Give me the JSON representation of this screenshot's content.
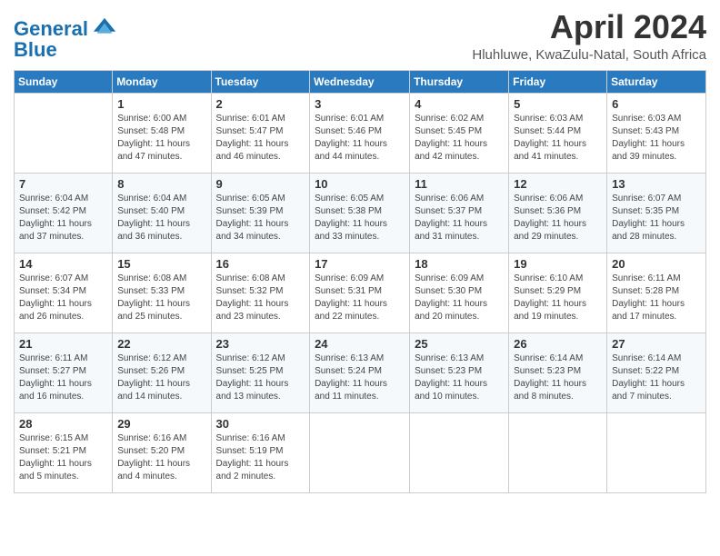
{
  "app": {
    "logo_line1": "General",
    "logo_line2": "Blue"
  },
  "header": {
    "month_year": "April 2024",
    "location": "Hluhluwe, KwaZulu-Natal, South Africa"
  },
  "calendar": {
    "days_of_week": [
      "Sunday",
      "Monday",
      "Tuesday",
      "Wednesday",
      "Thursday",
      "Friday",
      "Saturday"
    ],
    "weeks": [
      [
        {
          "day": "",
          "info": ""
        },
        {
          "day": "1",
          "info": "Sunrise: 6:00 AM\nSunset: 5:48 PM\nDaylight: 11 hours\nand 47 minutes."
        },
        {
          "day": "2",
          "info": "Sunrise: 6:01 AM\nSunset: 5:47 PM\nDaylight: 11 hours\nand 46 minutes."
        },
        {
          "day": "3",
          "info": "Sunrise: 6:01 AM\nSunset: 5:46 PM\nDaylight: 11 hours\nand 44 minutes."
        },
        {
          "day": "4",
          "info": "Sunrise: 6:02 AM\nSunset: 5:45 PM\nDaylight: 11 hours\nand 42 minutes."
        },
        {
          "day": "5",
          "info": "Sunrise: 6:03 AM\nSunset: 5:44 PM\nDaylight: 11 hours\nand 41 minutes."
        },
        {
          "day": "6",
          "info": "Sunrise: 6:03 AM\nSunset: 5:43 PM\nDaylight: 11 hours\nand 39 minutes."
        }
      ],
      [
        {
          "day": "7",
          "info": "Sunrise: 6:04 AM\nSunset: 5:42 PM\nDaylight: 11 hours\nand 37 minutes."
        },
        {
          "day": "8",
          "info": "Sunrise: 6:04 AM\nSunset: 5:40 PM\nDaylight: 11 hours\nand 36 minutes."
        },
        {
          "day": "9",
          "info": "Sunrise: 6:05 AM\nSunset: 5:39 PM\nDaylight: 11 hours\nand 34 minutes."
        },
        {
          "day": "10",
          "info": "Sunrise: 6:05 AM\nSunset: 5:38 PM\nDaylight: 11 hours\nand 33 minutes."
        },
        {
          "day": "11",
          "info": "Sunrise: 6:06 AM\nSunset: 5:37 PM\nDaylight: 11 hours\nand 31 minutes."
        },
        {
          "day": "12",
          "info": "Sunrise: 6:06 AM\nSunset: 5:36 PM\nDaylight: 11 hours\nand 29 minutes."
        },
        {
          "day": "13",
          "info": "Sunrise: 6:07 AM\nSunset: 5:35 PM\nDaylight: 11 hours\nand 28 minutes."
        }
      ],
      [
        {
          "day": "14",
          "info": "Sunrise: 6:07 AM\nSunset: 5:34 PM\nDaylight: 11 hours\nand 26 minutes."
        },
        {
          "day": "15",
          "info": "Sunrise: 6:08 AM\nSunset: 5:33 PM\nDaylight: 11 hours\nand 25 minutes."
        },
        {
          "day": "16",
          "info": "Sunrise: 6:08 AM\nSunset: 5:32 PM\nDaylight: 11 hours\nand 23 minutes."
        },
        {
          "day": "17",
          "info": "Sunrise: 6:09 AM\nSunset: 5:31 PM\nDaylight: 11 hours\nand 22 minutes."
        },
        {
          "day": "18",
          "info": "Sunrise: 6:09 AM\nSunset: 5:30 PM\nDaylight: 11 hours\nand 20 minutes."
        },
        {
          "day": "19",
          "info": "Sunrise: 6:10 AM\nSunset: 5:29 PM\nDaylight: 11 hours\nand 19 minutes."
        },
        {
          "day": "20",
          "info": "Sunrise: 6:11 AM\nSunset: 5:28 PM\nDaylight: 11 hours\nand 17 minutes."
        }
      ],
      [
        {
          "day": "21",
          "info": "Sunrise: 6:11 AM\nSunset: 5:27 PM\nDaylight: 11 hours\nand 16 minutes."
        },
        {
          "day": "22",
          "info": "Sunrise: 6:12 AM\nSunset: 5:26 PM\nDaylight: 11 hours\nand 14 minutes."
        },
        {
          "day": "23",
          "info": "Sunrise: 6:12 AM\nSunset: 5:25 PM\nDaylight: 11 hours\nand 13 minutes."
        },
        {
          "day": "24",
          "info": "Sunrise: 6:13 AM\nSunset: 5:24 PM\nDaylight: 11 hours\nand 11 minutes."
        },
        {
          "day": "25",
          "info": "Sunrise: 6:13 AM\nSunset: 5:23 PM\nDaylight: 11 hours\nand 10 minutes."
        },
        {
          "day": "26",
          "info": "Sunrise: 6:14 AM\nSunset: 5:23 PM\nDaylight: 11 hours\nand 8 minutes."
        },
        {
          "day": "27",
          "info": "Sunrise: 6:14 AM\nSunset: 5:22 PM\nDaylight: 11 hours\nand 7 minutes."
        }
      ],
      [
        {
          "day": "28",
          "info": "Sunrise: 6:15 AM\nSunset: 5:21 PM\nDaylight: 11 hours\nand 5 minutes."
        },
        {
          "day": "29",
          "info": "Sunrise: 6:16 AM\nSunset: 5:20 PM\nDaylight: 11 hours\nand 4 minutes."
        },
        {
          "day": "30",
          "info": "Sunrise: 6:16 AM\nSunset: 5:19 PM\nDaylight: 11 hours\nand 2 minutes."
        },
        {
          "day": "",
          "info": ""
        },
        {
          "day": "",
          "info": ""
        },
        {
          "day": "",
          "info": ""
        },
        {
          "day": "",
          "info": ""
        }
      ]
    ]
  }
}
